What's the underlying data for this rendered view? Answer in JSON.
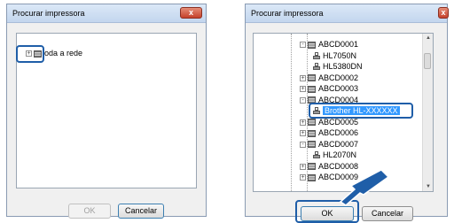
{
  "left_dialog": {
    "title": "Procurar impressora",
    "close_label": "x",
    "tree_item": "oda a rede",
    "ok_label": "OK",
    "cancel_label": "Cancelar"
  },
  "right_dialog": {
    "title": "Procurar impressora",
    "close_label": "x",
    "tree": [
      {
        "label": "ABCD0001",
        "kind": "group",
        "expander": "-"
      },
      {
        "label": "HL7050N",
        "kind": "printer"
      },
      {
        "label": "HL5380DN",
        "kind": "printer"
      },
      {
        "label": "ABCD0002",
        "kind": "group",
        "expander": "+"
      },
      {
        "label": "ABCD0003",
        "kind": "group",
        "expander": "+"
      },
      {
        "label": "ABCD0004",
        "kind": "group",
        "expander": "-"
      },
      {
        "label": "Brother HL-XXXXXX",
        "kind": "printer",
        "selected": true
      },
      {
        "label": "ABCD0005",
        "kind": "group",
        "expander": "+"
      },
      {
        "label": "ABCD0006",
        "kind": "group",
        "expander": "+"
      },
      {
        "label": "ABCD0007",
        "kind": "group",
        "expander": "-"
      },
      {
        "label": "HL2070N",
        "kind": "printer"
      },
      {
        "label": "ABCD0008",
        "kind": "group",
        "expander": "+"
      },
      {
        "label": "ABCD0009",
        "kind": "group",
        "expander": "+"
      }
    ],
    "ok_label": "OK",
    "cancel_label": "Cancelar"
  },
  "colors": {
    "highlight": "#1f5ea8",
    "selection": "#3399ff"
  }
}
